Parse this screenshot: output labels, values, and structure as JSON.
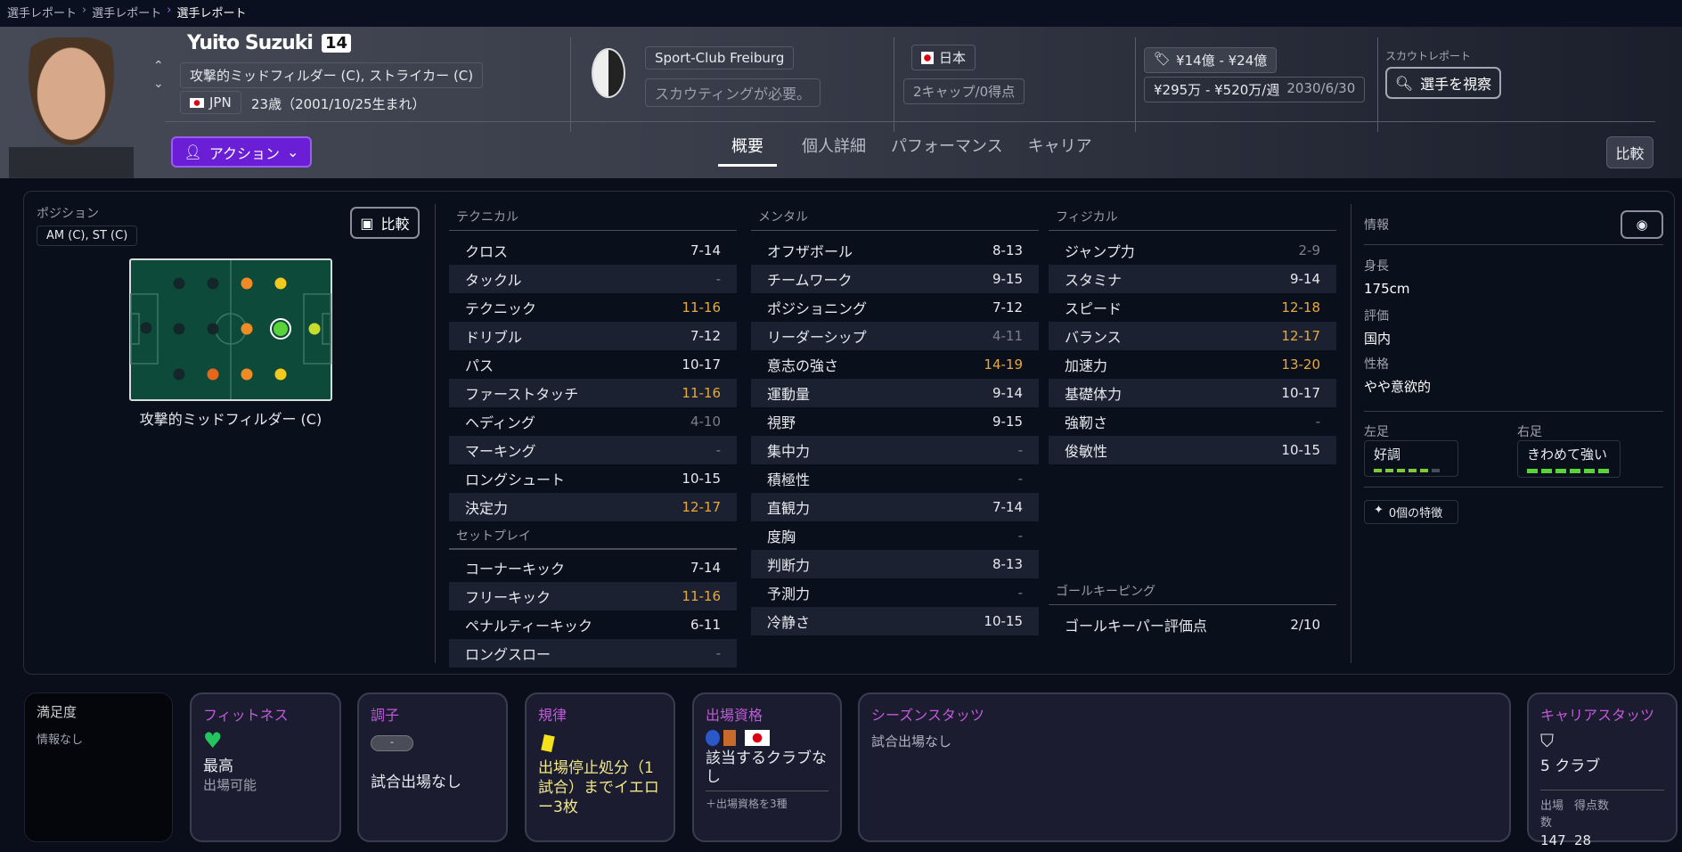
{
  "breadcrumb": [
    "選手レポート",
    "選手レポート",
    "選手レポート"
  ],
  "player": {
    "name": "Yuito Suzuki",
    "number": "14",
    "positions": "攻撃的ミッドフィルダー (C), ストライカー (C)",
    "nation_code": "JPN",
    "age": "23歳（2001/10/25生まれ）"
  },
  "club": {
    "name": "Sport-Club Freiburg",
    "scouting": "スカウティングが必要。"
  },
  "national": {
    "country": "日本",
    "caps": "2キャップ/0得点"
  },
  "contract": {
    "value": "¥14億 - ¥24億",
    "wage": "¥295万 - ¥520万/週",
    "expiry": "2030/6/30"
  },
  "scout": {
    "label": "スカウトレポート",
    "button": "選手を視察"
  },
  "action_button": "アクション",
  "tabs": [
    {
      "label": "概要",
      "active": true
    },
    {
      "label": "個人詳細"
    },
    {
      "label": "パフォーマンス"
    },
    {
      "label": "キャリア"
    }
  ],
  "compare_label": "比較",
  "position": {
    "title": "ポジション",
    "tag": "AM (C), ST (C)",
    "compare": "比較",
    "selected_label": "攻撃的ミッドフィルダー (C)",
    "pitch": [
      {
        "pos": "GK",
        "rating": "none"
      },
      {
        "pos": "DL",
        "rating": "none"
      },
      {
        "pos": "DC",
        "rating": "none"
      },
      {
        "pos": "DR",
        "rating": "none"
      },
      {
        "pos": "WBL",
        "rating": "none"
      },
      {
        "pos": "DM",
        "rating": "none"
      },
      {
        "pos": "WBR",
        "rating": "poor"
      },
      {
        "pos": "ML",
        "rating": "fair"
      },
      {
        "pos": "MC",
        "rating": "fair"
      },
      {
        "pos": "MR",
        "rating": "fair"
      },
      {
        "pos": "AML",
        "rating": "good"
      },
      {
        "pos": "AMC",
        "rating": "natural",
        "selected": true
      },
      {
        "pos": "AMR",
        "rating": "good"
      },
      {
        "pos": "ST",
        "rating": "strong"
      }
    ],
    "rating_colors": {
      "none": "#13272a",
      "poor": "#e8661c",
      "fair": "#f08a24",
      "good": "#f2c91e",
      "strong": "#c8dc2c",
      "natural": "#5ad23a"
    }
  },
  "technical": {
    "title": "テクニカル",
    "rows": [
      [
        "クロス",
        "7-14",
        ""
      ],
      [
        "タックル",
        "-",
        "na"
      ],
      [
        "テクニック",
        "11-16",
        "hi"
      ],
      [
        "ドリブル",
        "7-12",
        ""
      ],
      [
        "パス",
        "10-17",
        ""
      ],
      [
        "ファーストタッチ",
        "11-16",
        "hi"
      ],
      [
        "ヘディング",
        "4-10",
        "lo"
      ],
      [
        "マーキング",
        "-",
        "na"
      ],
      [
        "ロングシュート",
        "10-15",
        ""
      ],
      [
        "決定力",
        "12-17",
        "hi"
      ]
    ]
  },
  "setpiece": {
    "title": "セットプレイ",
    "rows": [
      [
        "コーナーキック",
        "7-14",
        ""
      ],
      [
        "フリーキック",
        "11-16",
        "hi"
      ],
      [
        "ペナルティーキック",
        "6-11",
        ""
      ],
      [
        "ロングスロー",
        "-",
        "na"
      ]
    ]
  },
  "mental": {
    "title": "メンタル",
    "rows": [
      [
        "オフザボール",
        "8-13",
        ""
      ],
      [
        "チームワーク",
        "9-15",
        ""
      ],
      [
        "ポジショニング",
        "7-12",
        ""
      ],
      [
        "リーダーシップ",
        "4-11",
        "lo"
      ],
      [
        "意志の強さ",
        "14-19",
        "hi"
      ],
      [
        "運動量",
        "9-14",
        ""
      ],
      [
        "視野",
        "9-15",
        ""
      ],
      [
        "集中力",
        "-",
        "na"
      ],
      [
        "積極性",
        "-",
        "na"
      ],
      [
        "直観力",
        "7-14",
        ""
      ],
      [
        "度胸",
        "-",
        "na"
      ],
      [
        "判断力",
        "8-13",
        ""
      ],
      [
        "予測力",
        "-",
        "na"
      ],
      [
        "冷静さ",
        "10-15",
        ""
      ]
    ]
  },
  "physical": {
    "title": "フィジカル",
    "rows": [
      [
        "ジャンプ力",
        "2-9",
        "lo"
      ],
      [
        "スタミナ",
        "9-14",
        ""
      ],
      [
        "スピード",
        "12-18",
        "hi"
      ],
      [
        "バランス",
        "12-17",
        "hi"
      ],
      [
        "加速力",
        "13-20",
        "hi"
      ],
      [
        "基礎体力",
        "10-17",
        ""
      ],
      [
        "強靭さ",
        "-",
        "na"
      ],
      [
        "俊敏性",
        "10-15",
        ""
      ]
    ]
  },
  "goalkeeping": {
    "title": "ゴールキーピング",
    "rows": [
      [
        "ゴールキーパー評価点",
        "2/10",
        ""
      ]
    ]
  },
  "info": {
    "title": "情報",
    "height_label": "身長",
    "height": "175cm",
    "rep_label": "評価",
    "rep": "国内",
    "personality_label": "性格",
    "personality": "やや意欲的",
    "left_foot_label": "左足",
    "left_foot": "好調",
    "left_foot_level": 5,
    "right_foot_label": "右足",
    "right_foot": "きわめて強い",
    "right_foot_level": 6,
    "traits": "0個の特徴"
  },
  "cards": {
    "satisfaction": {
      "title": "満足度",
      "text": "情報なし"
    },
    "fitness": {
      "title": "フィットネス",
      "value": "最高",
      "sub": "出場可能"
    },
    "form": {
      "title": "調子",
      "pill": "-",
      "text": "試合出場なし"
    },
    "discipline": {
      "title": "規律",
      "text": "出場停止処分（1試合）までイエロー3枚"
    },
    "eligibility": {
      "title": "出場資格",
      "text": "該当するクラブなし",
      "more": "＋出場資格を3種"
    },
    "season": {
      "title": "シーズンスタッツ",
      "text": "試合出場なし"
    },
    "career": {
      "title": "キャリアスタッツ",
      "clubs": "5 クラブ",
      "apps_label": "出場数",
      "goals_label": "得点数",
      "apps": "147",
      "goals": "28"
    }
  }
}
